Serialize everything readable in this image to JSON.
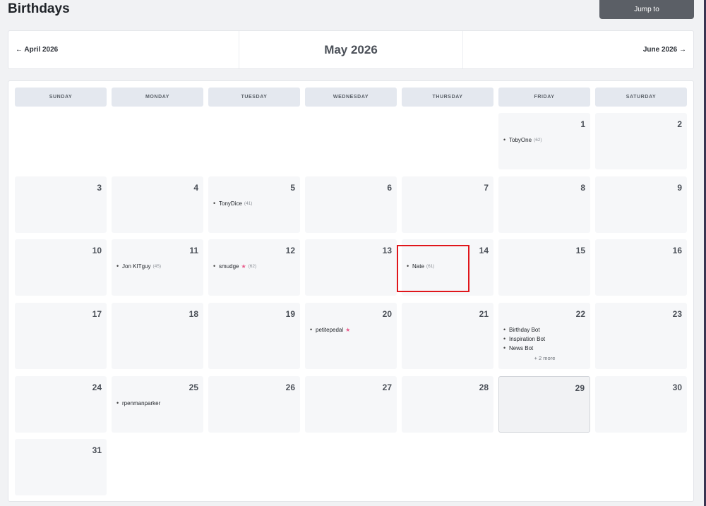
{
  "page": {
    "title": "Birthdays",
    "jump_label": "Jump to"
  },
  "nav": {
    "prev": "← April 2026",
    "current": "May 2026",
    "next": "June 2026 →"
  },
  "weekdays": [
    "SUNDAY",
    "MONDAY",
    "TUESDAY",
    "WEDNESDAY",
    "THURSDAY",
    "FRIDAY",
    "SATURDAY"
  ],
  "days": {
    "d1": {
      "num": "1",
      "entries": [
        {
          "name": "TobyOne",
          "age": "(62)"
        }
      ]
    },
    "d2": {
      "num": "2"
    },
    "d3": {
      "num": "3"
    },
    "d4": {
      "num": "4"
    },
    "d5": {
      "num": "5",
      "entries": [
        {
          "name": "TonyDice",
          "age": "(41)"
        }
      ]
    },
    "d6": {
      "num": "6"
    },
    "d7": {
      "num": "7"
    },
    "d8": {
      "num": "8"
    },
    "d9": {
      "num": "9"
    },
    "d10": {
      "num": "10"
    },
    "d11": {
      "num": "11",
      "entries": [
        {
          "name": "Jon KITguy",
          "age": "(45)"
        }
      ]
    },
    "d12": {
      "num": "12",
      "entries": [
        {
          "name": "smudge",
          "star": "★",
          "age": "(62)"
        }
      ]
    },
    "d13": {
      "num": "13"
    },
    "d14": {
      "num": "14",
      "entries": [
        {
          "name": "Nate",
          "age": "(61)"
        }
      ]
    },
    "d15": {
      "num": "15"
    },
    "d16": {
      "num": "16"
    },
    "d17": {
      "num": "17"
    },
    "d18": {
      "num": "18"
    },
    "d19": {
      "num": "19"
    },
    "d20": {
      "num": "20",
      "entries": [
        {
          "name": "petitepedal",
          "star": "★"
        }
      ]
    },
    "d21": {
      "num": "21"
    },
    "d22": {
      "num": "22",
      "entries": [
        {
          "name": "Birthday Bot"
        },
        {
          "name": "Inspiration Bot"
        },
        {
          "name": "News Bot"
        }
      ],
      "more": "+ 2 more"
    },
    "d23": {
      "num": "23"
    },
    "d24": {
      "num": "24"
    },
    "d25": {
      "num": "25",
      "entries": [
        {
          "name": "rpenmanparker"
        }
      ]
    },
    "d26": {
      "num": "26"
    },
    "d27": {
      "num": "27"
    },
    "d28": {
      "num": "28"
    },
    "d29": {
      "num": "29"
    },
    "d30": {
      "num": "30"
    },
    "d31": {
      "num": "31"
    }
  },
  "bullet": "•",
  "colors": {
    "accent_star": "#e85a8a",
    "highlight": "#e0161b",
    "jump_button": "#5b5f66"
  }
}
